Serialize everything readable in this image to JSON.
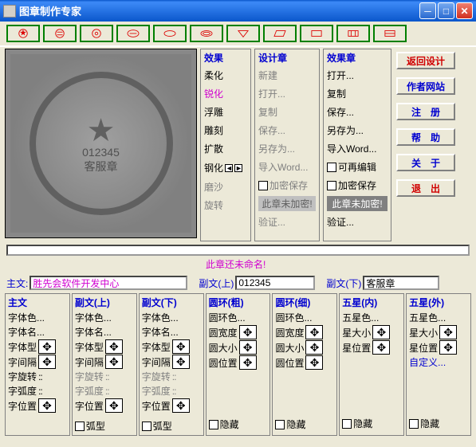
{
  "title": "图章制作专家",
  "effects": {
    "header": "效果",
    "items": [
      "柔化",
      "锐化",
      "浮雕",
      "雕刻",
      "扩散",
      "钢化",
      "磨沙",
      "旋转"
    ]
  },
  "design": {
    "header": "设计章",
    "items": [
      "新建",
      "打开...",
      "复制",
      "保存...",
      "另存为...",
      "导入Word...",
      "加密保存",
      "此章未加密!",
      "验证..."
    ]
  },
  "effectchap": {
    "header": "效果章",
    "items": [
      "打开...",
      "复制",
      "保存...",
      "另存为...",
      "导入Word...",
      "可再编辑",
      "加密保存",
      "此章未加密!",
      "验证..."
    ]
  },
  "sidebuttons": [
    "返回设计",
    "作者网站",
    "注　册",
    "帮　助",
    "关　于",
    "退　出"
  ],
  "untitled": "此章还未命名!",
  "mainfields": {
    "zhuwen_label": "主文:",
    "zhuwen_val": "胜先会软件开发中心",
    "fushang_label": "副文(上)",
    "fushang_val": "012345",
    "fuxia_label": "副文(下)",
    "fuxia_val": "客服章"
  },
  "seal": {
    "num": "012345",
    "bottom": "客服章"
  },
  "panelheads": [
    "主文",
    "副文(上)",
    "副文(下)",
    "圆环(粗)",
    "圆环(细)",
    "五星(内)",
    "五星(外)"
  ],
  "textpanel": {
    "r1": "字体色...",
    "r2": "字体名...",
    "r3": "字体型",
    "r4": "字间隔",
    "r5": "字旋转",
    "r6": "字弧度",
    "r7": "字位置",
    "chk": "弧型"
  },
  "ringpanel": {
    "r1": "圆环色...",
    "r2": "圆宽度",
    "r3": "圆大小",
    "r4": "圆位置",
    "chk": "隐藏"
  },
  "starpanel": {
    "r1": "五星色...",
    "r2": "星大小",
    "r3": "星位置",
    "r4": "自定义...",
    "chk": "隐藏"
  }
}
